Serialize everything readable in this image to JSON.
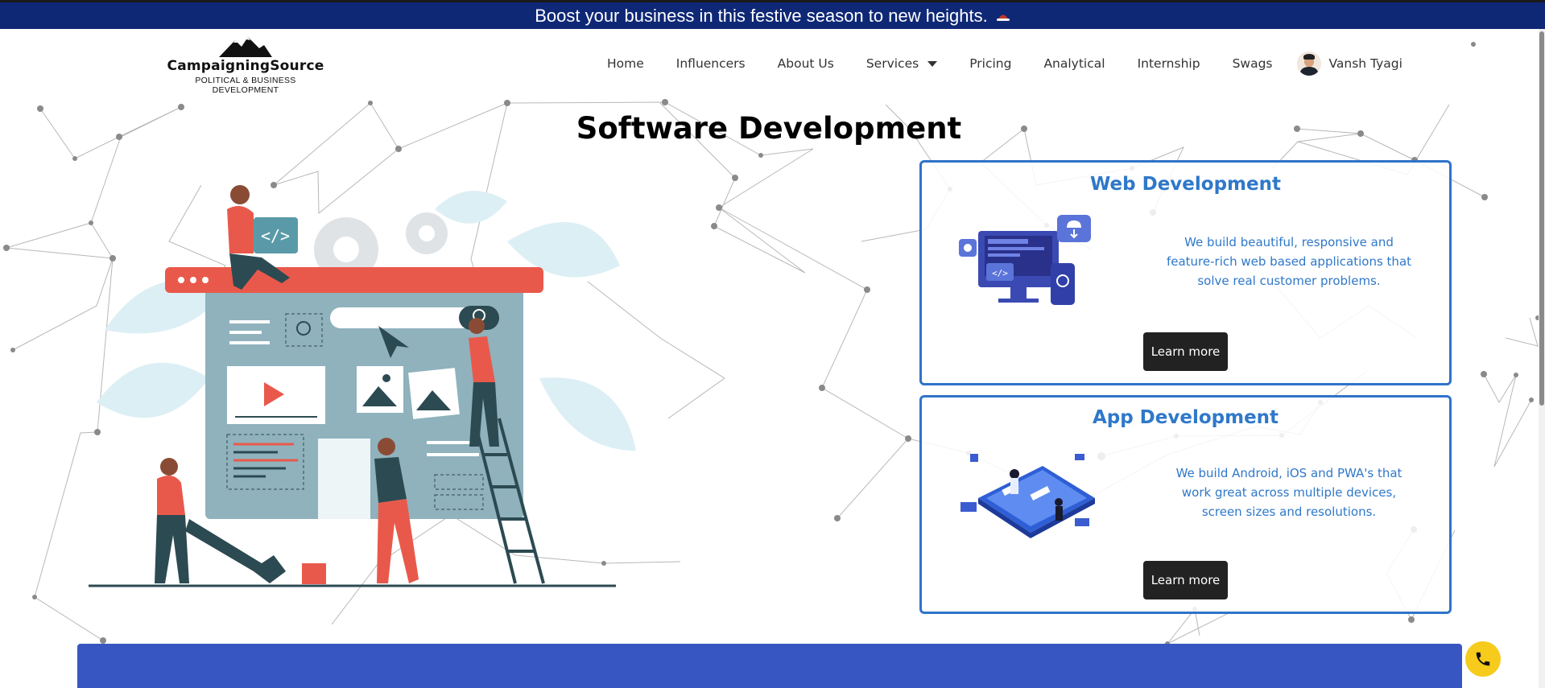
{
  "announcement": {
    "text": "Boost your business in this festive season to new heights."
  },
  "brand": {
    "name": "CampaigningSource",
    "tagline": "POLITICAL & BUSINESS DEVELOPMENT"
  },
  "nav": {
    "items": [
      {
        "label": "Home"
      },
      {
        "label": "Influencers"
      },
      {
        "label": "About Us"
      },
      {
        "label": "Services"
      },
      {
        "label": "Pricing"
      },
      {
        "label": "Analytical"
      },
      {
        "label": "Internship"
      },
      {
        "label": "Swags"
      }
    ],
    "user_name": "Vansh Tyagi"
  },
  "page": {
    "title": "Software Development"
  },
  "services": [
    {
      "title": "Web Development",
      "description": "We build beautiful, responsive and feature-rich web based applications that solve real customer problems.",
      "button": "Learn more"
    },
    {
      "title": "App Development",
      "description": "We build Android, iOS and PWA's that work great across multiple devices, screen sizes and resolutions.",
      "button": "Learn more"
    }
  ],
  "colors": {
    "announcement_bg": "#0f2876",
    "accent_blue": "#2f78c9",
    "band_blue": "#3756c2",
    "button_dark": "#222222",
    "phone_yellow": "#f6cb1c"
  },
  "icons": {
    "phone": "phone-icon",
    "caret": "chevron-down-icon"
  }
}
